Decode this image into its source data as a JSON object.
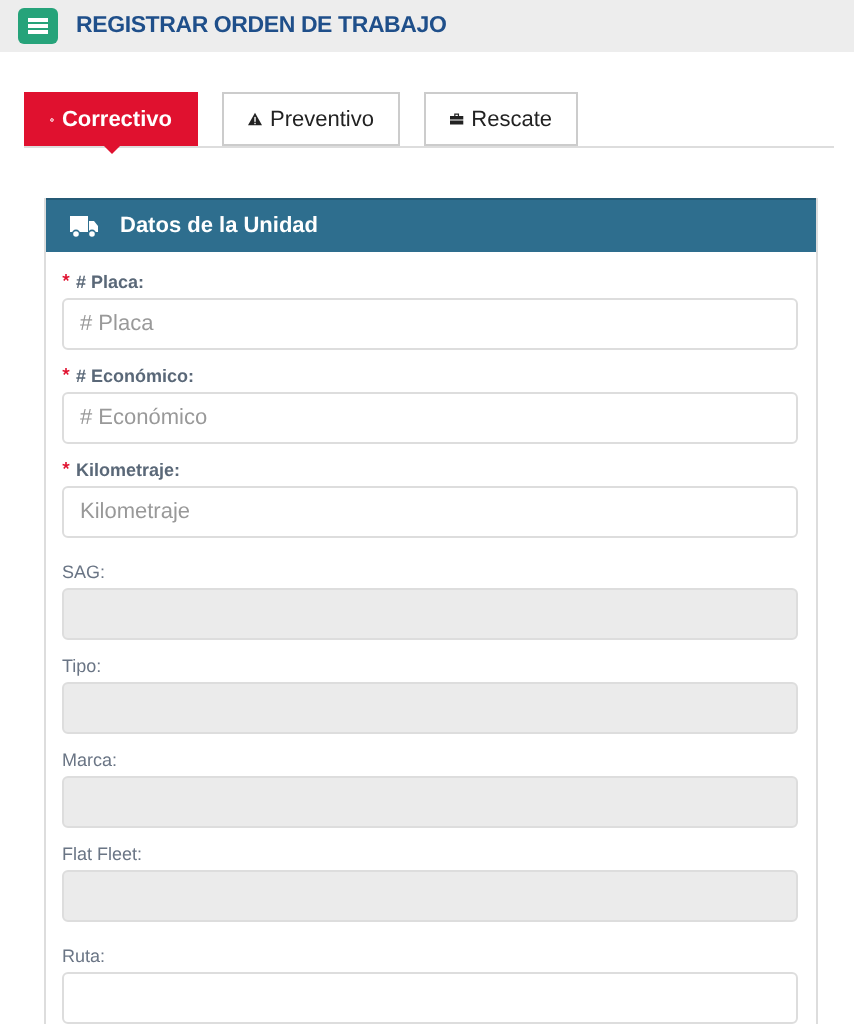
{
  "header": {
    "title": "REGISTRAR ORDEN DE TRABAJO"
  },
  "tabs": [
    {
      "label": "Correctivo",
      "selected": true
    },
    {
      "label": "Preventivo",
      "selected": false
    },
    {
      "label": "Rescate",
      "selected": false
    }
  ],
  "panel": {
    "title": "Datos de la Unidad",
    "field_groups": [
      [
        {
          "label": "# Placa:",
          "placeholder": "# Placa",
          "required": true,
          "disabled": false
        },
        {
          "label": "# Económico:",
          "placeholder": "# Económico",
          "required": true,
          "disabled": false
        },
        {
          "label": "Kilometraje:",
          "placeholder": "Kilometraje",
          "required": true,
          "disabled": false
        }
      ],
      [
        {
          "label": "SAG:",
          "required": false,
          "disabled": true
        },
        {
          "label": "Tipo:",
          "required": false,
          "disabled": true
        },
        {
          "label": "Marca:",
          "required": false,
          "disabled": true
        },
        {
          "label": "Flat Fleet:",
          "required": false,
          "disabled": true
        }
      ],
      [
        {
          "label": "Ruta:",
          "required": false,
          "disabled": false
        }
      ]
    ]
  }
}
